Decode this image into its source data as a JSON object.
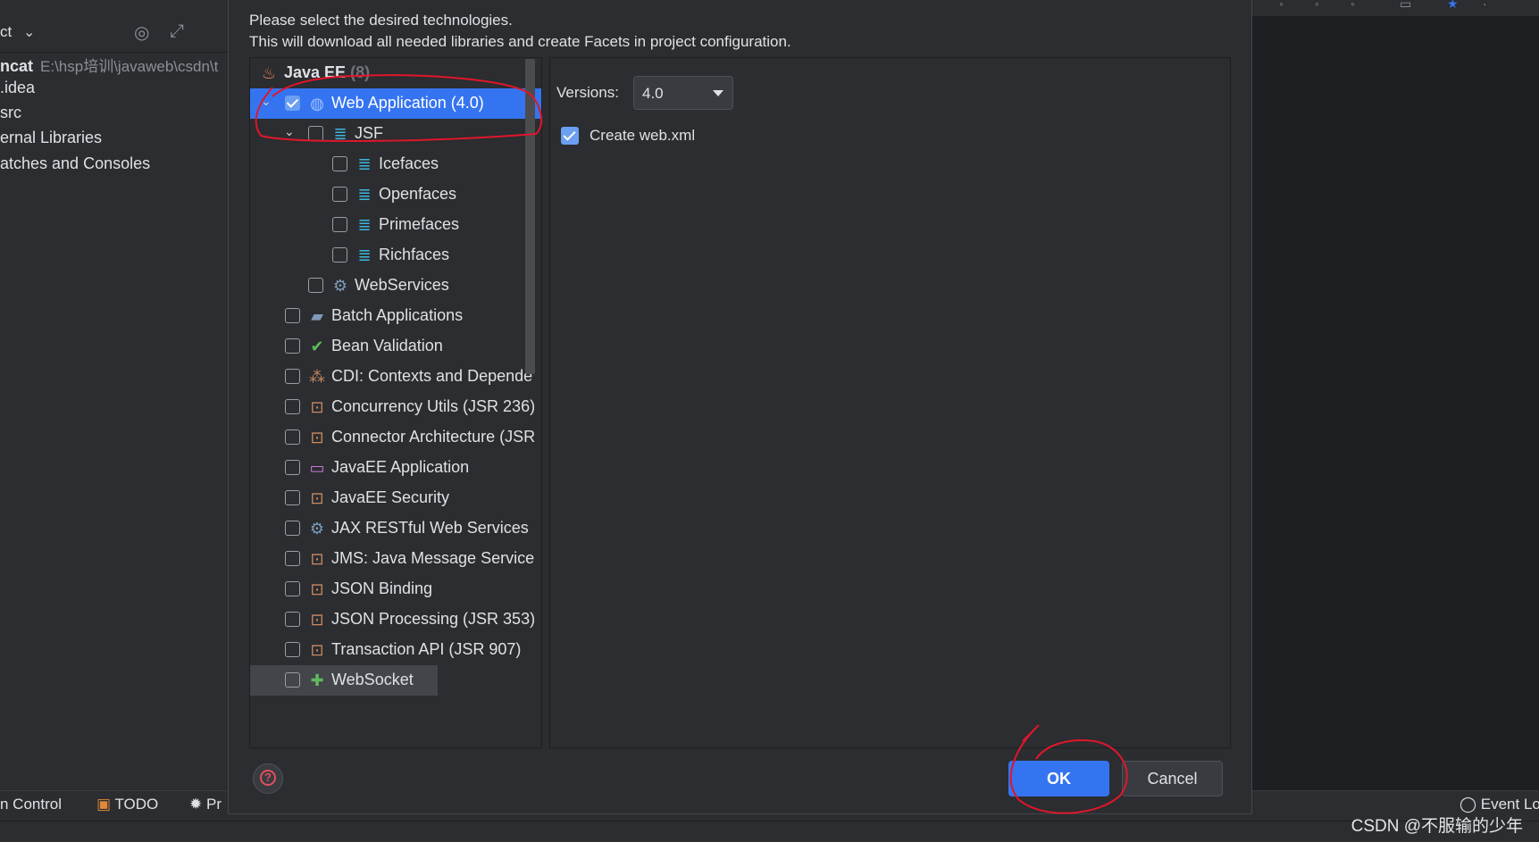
{
  "ide": {
    "project_header": {
      "title": "ct"
    },
    "project_tree": [
      {
        "name": "ncat",
        "path": "E:\\hsp培训\\javaweb\\csdn\\t"
      },
      {
        "name": ".idea"
      },
      {
        "name": "src"
      },
      {
        "name": "ernal Libraries"
      },
      {
        "name": "atches and Consoles"
      }
    ],
    "bottom_bar": {
      "version_control": "n Control",
      "todo": "TODO",
      "problems": "Pr",
      "event_log": "Event Lo"
    },
    "watermark": "CSDN @不服输的少年"
  },
  "dialog": {
    "description_line1": "Please select the desired technologies.",
    "description_line2": "This will download all needed libraries and create Facets in project configuration.",
    "tree": {
      "group_label": "Java EE",
      "group_count": "(8)",
      "items": [
        {
          "label": "Web Application (4.0)",
          "checked": true,
          "selected": true
        },
        {
          "label": "JSF",
          "checked": false
        },
        {
          "label": "Icefaces",
          "checked": false
        },
        {
          "label": "Openfaces",
          "checked": false
        },
        {
          "label": "Primefaces",
          "checked": false
        },
        {
          "label": "Richfaces",
          "checked": false
        },
        {
          "label": "WebServices",
          "checked": false
        },
        {
          "label": "Batch Applications",
          "checked": false
        },
        {
          "label": "Bean Validation",
          "checked": false
        },
        {
          "label": "CDI: Contexts and Depende",
          "checked": false
        },
        {
          "label": "Concurrency Utils (JSR 236)",
          "checked": false
        },
        {
          "label": "Connector Architecture (JSR",
          "checked": false
        },
        {
          "label": "JavaEE Application",
          "checked": false
        },
        {
          "label": "JavaEE Security",
          "checked": false
        },
        {
          "label": "JAX RESTful Web Services",
          "checked": false
        },
        {
          "label": "JMS: Java Message Service",
          "checked": false
        },
        {
          "label": "JSON Binding",
          "checked": false
        },
        {
          "label": "JSON Processing (JSR 353)",
          "checked": false
        },
        {
          "label": "Transaction API (JSR 907)",
          "checked": false
        },
        {
          "label": "WebSocket",
          "checked": false
        }
      ]
    },
    "detail": {
      "versions_label": "Versions:",
      "versions_value": "4.0",
      "create_webxml_label": "Create web.xml",
      "create_webxml_checked": true
    },
    "buttons": {
      "ok": "OK",
      "cancel": "Cancel"
    }
  },
  "colors": {
    "accent": "#3574f0",
    "annotation": "#e0162b"
  },
  "icons": {
    "java_ee": "java-cup-icon",
    "web_app": "globe-icon",
    "jsf": "jsf-icon",
    "webservices": "gear-icon",
    "batch": "folder-icon",
    "bean_validation": "bean-check-icon",
    "cdi": "beans-icon",
    "javaee_generic": "javaee-module-icon",
    "help": "help-icon"
  }
}
